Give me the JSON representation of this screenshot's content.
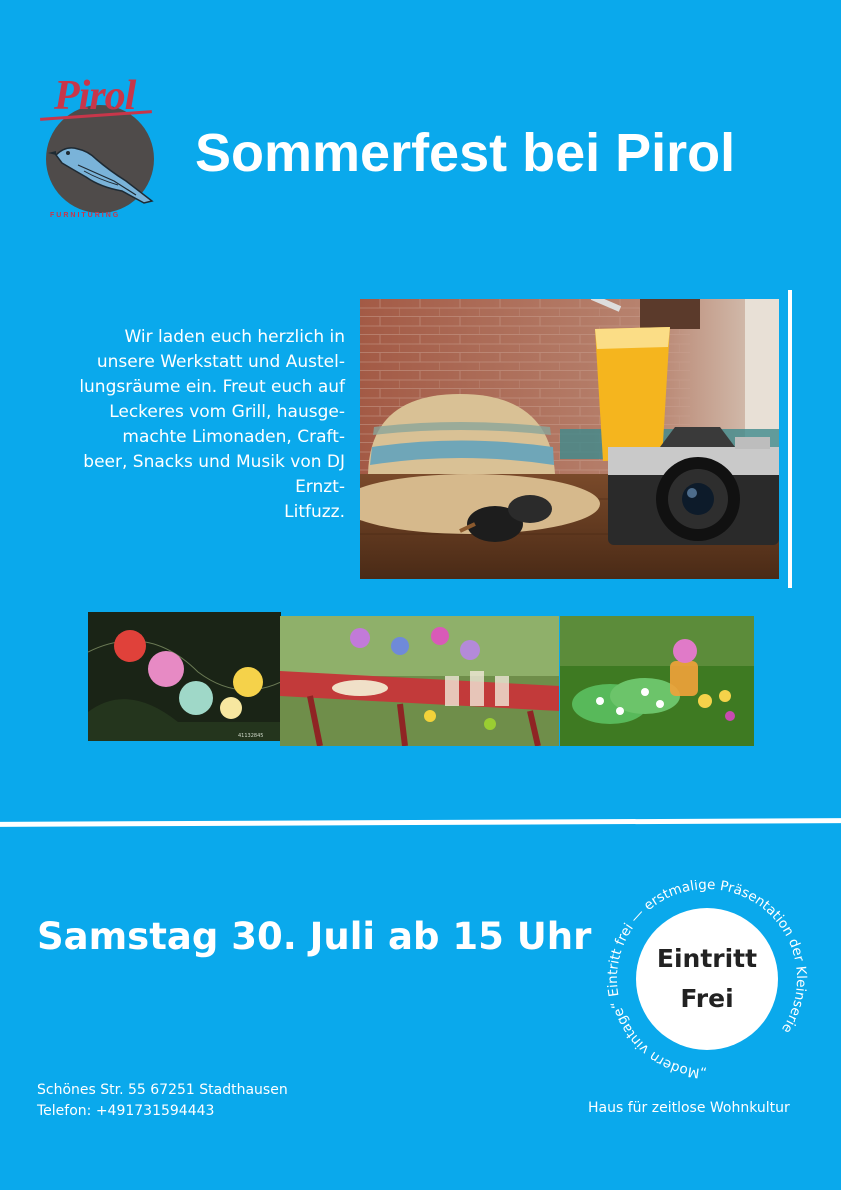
{
  "logo": {
    "wordmark": "Pirol",
    "tagline": "FURNITURING"
  },
  "title": "Sommerfest bei Pirol",
  "intro": "Wir laden euch herzlich in unsere Werkstatt und Austel-lungsräume ein. Freut euch auf Leckeres vom Grill, hausge-machte Limonaden, Craft-beer, Snacks und Musik von DJ Ernzt-Litfuzz.",
  "intro_lines": [
    "Wir laden euch herzlich in",
    "unsere Werkstatt und Austel-",
    "lungsräume ein. Freut euch auf",
    "Leckeres vom Grill, hausge-",
    "machte Limonaden, Craft-",
    "beer, Snacks und Musik von DJ",
    "Ernzt-",
    "Litfuzz."
  ],
  "event_date": "Samstag 30. Juli ab 15 Uhr",
  "badge": {
    "line1": "Eintritt",
    "line2": "Frei",
    "ring_text": "„Modern vintage“ Eintritt frei — erstmalige Präsentation der Kleinserie"
  },
  "address": {
    "street": "Schönes Str. 55 67251 Stadthausen",
    "phone": "Telefon: +491731594443"
  },
  "tagline": "Haus für zeitlose Wohnkultur",
  "photo_caption": "41132845"
}
